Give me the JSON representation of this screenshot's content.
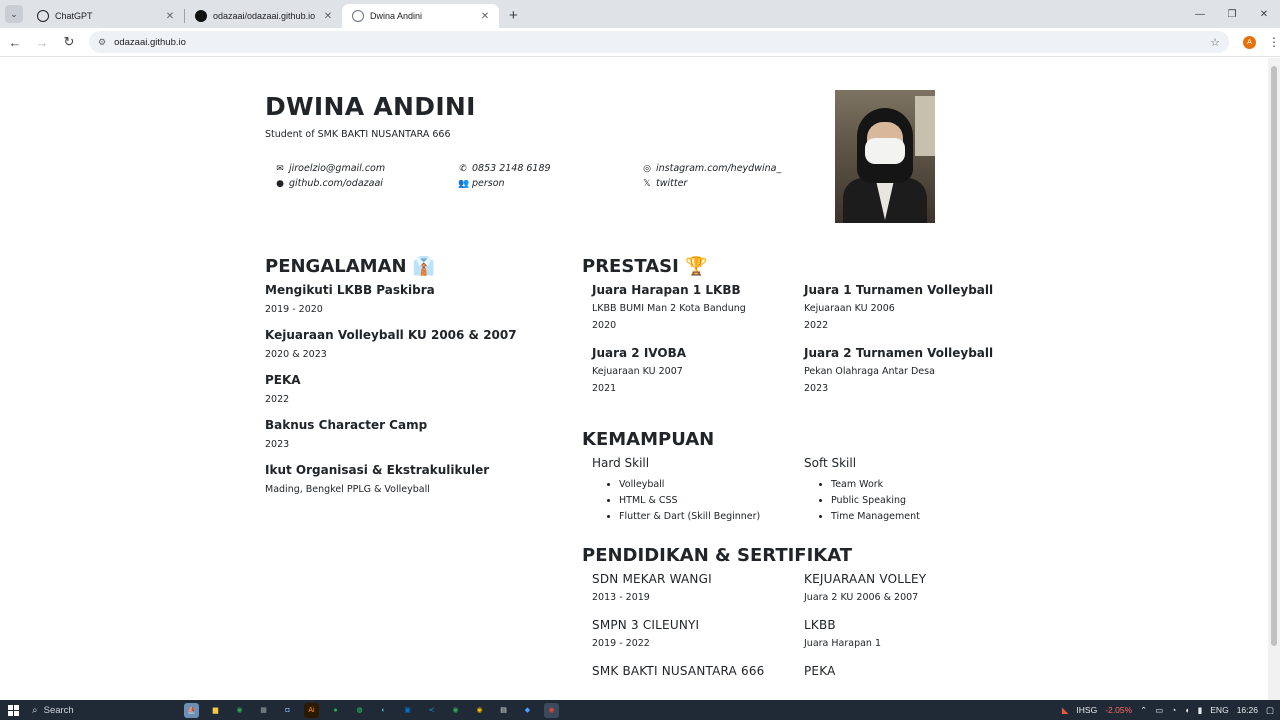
{
  "browser": {
    "tabs": [
      {
        "title": "ChatGPT",
        "favicon_color": "#202124",
        "active": false
      },
      {
        "title": "odazaai/odazaai.github.io",
        "favicon_color": "#111111",
        "active": false
      },
      {
        "title": "Dwina Andini",
        "favicon_color": "#6b7380",
        "active": true
      }
    ],
    "url": "odazaai.github.io",
    "profile_initial": "A",
    "accent_color": "#e8710a"
  },
  "profile": {
    "name": "DWINA ANDINI",
    "subtitle": "Student of SMK BAKTI NUSANTARA 666",
    "contacts": [
      {
        "icon": "mail-icon",
        "glyph": "✉",
        "text": "jiroelzio@gmail.com"
      },
      {
        "icon": "phone-icon",
        "glyph": "✆",
        "text": "0853 2148 6189"
      },
      {
        "icon": "instagram-icon",
        "glyph": "◎",
        "text": "instagram.com/heydwina_"
      },
      {
        "icon": "github-icon",
        "glyph": "●",
        "text": "github.com/odazaai"
      },
      {
        "icon": "person-icon",
        "glyph": "👥",
        "text": "person"
      },
      {
        "icon": "x-icon",
        "glyph": "𝕏",
        "text": "twitter"
      }
    ]
  },
  "pengalaman": {
    "title": "PENGALAMAN 👔",
    "items": [
      {
        "title": "Mengikuti LKBB Paskibra",
        "detail": "2019 - 2020"
      },
      {
        "title": "Kejuaraan Volleyball KU 2006 & 2007",
        "detail": "2020 & 2023"
      },
      {
        "title": "PEKA",
        "detail": "2022"
      },
      {
        "title": "Baknus Character Camp",
        "detail": "2023"
      },
      {
        "title": "Ikut Organisasi & Ekstrakulikuler",
        "detail": "Mading, Bengkel PPLG & Volleyball"
      }
    ]
  },
  "prestasi": {
    "title": "PRESTASI 🏆",
    "items": [
      {
        "title": "Juara Harapan 1 LKBB",
        "event": "LKBB BUMI Man 2 Kota Bandung",
        "year": "2020"
      },
      {
        "title": "Juara 1 Turnamen Volleyball",
        "event": "Kejuaraan KU 2006",
        "year": "2022"
      },
      {
        "title": "Juara 2 IVOBA",
        "event": "Kejuaraan KU 2007",
        "year": "2021"
      },
      {
        "title": "Juara 2 Turnamen Volleyball",
        "event": "Pekan Olahraga Antar Desa",
        "year": "2023"
      }
    ]
  },
  "kemampuan": {
    "title": "KEMAMPUAN",
    "hard": {
      "title": "Hard Skill",
      "items": [
        "Volleyball",
        "HTML & CSS",
        "Flutter & Dart (Skill Beginner)"
      ]
    },
    "soft": {
      "title": "Soft Skill",
      "items": [
        "Team Work",
        "Public Speaking",
        "Time Management"
      ]
    }
  },
  "pendidikan": {
    "title": "PENDIDIKAN & SERTIFIKAT",
    "schools": [
      {
        "title": "SDN MEKAR WANGI",
        "detail": "2013 - 2019"
      },
      {
        "title": "SMPN 3 CILEUNYI",
        "detail": "2019 - 2022"
      },
      {
        "title": "SMK BAKTI NUSANTARA 666",
        "detail": ""
      }
    ],
    "certs": [
      {
        "title": "KEJUARAAN VOLLEY",
        "detail": "Juara 2 KU 2006 & 2007"
      },
      {
        "title": "LKBB",
        "detail": "Juara Harapan 1"
      },
      {
        "title": "PEKA",
        "detail": ""
      }
    ]
  },
  "taskbar": {
    "search_label": "Search",
    "ticker": "IHSG",
    "ticker_change": "-2.05%",
    "language": "ENG",
    "time": "16:26"
  }
}
